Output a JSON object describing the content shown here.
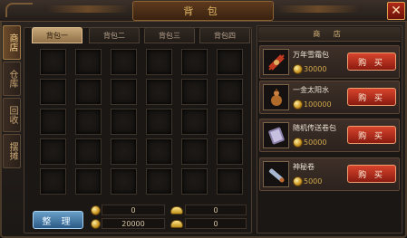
{
  "window": {
    "title": "背 包",
    "close_symbol": "✕"
  },
  "side_tabs": [
    {
      "label": "商店",
      "active": true
    },
    {
      "label": "仓库",
      "active": false
    },
    {
      "label": "回收",
      "active": false
    },
    {
      "label": "摆摊",
      "active": false
    }
  ],
  "bag_tabs": [
    {
      "label": "背包一",
      "active": true
    },
    {
      "label": "背包二",
      "active": false
    },
    {
      "label": "背包三",
      "active": false
    },
    {
      "label": "背包四",
      "active": false
    }
  ],
  "grid": {
    "rows": 5,
    "cols": 6
  },
  "bottom": {
    "sort_label": "整 理",
    "gold_bound": "0",
    "ingot_bound": "0",
    "gold": "20000",
    "ingot": "0"
  },
  "shop": {
    "title": "商 店",
    "items": [
      {
        "name": "万年雪霜包",
        "price": "30000",
        "icon": "snow-bundle-icon",
        "buy_label": "购 买"
      },
      {
        "name": "一金太阳水",
        "price": "100000",
        "icon": "potion-gourd-icon",
        "buy_label": "购 买"
      },
      {
        "name": "随机传送卷包",
        "price": "50000",
        "icon": "scroll-bundle-icon",
        "buy_label": "购 买"
      },
      {
        "name": "神秘卷",
        "price": "5000",
        "icon": "scroll-icon",
        "buy_label": "购 买"
      }
    ]
  },
  "colors": {
    "accent_gold": "#e3b866",
    "buy_red": "#c4301c",
    "sort_blue": "#3f78a8"
  }
}
